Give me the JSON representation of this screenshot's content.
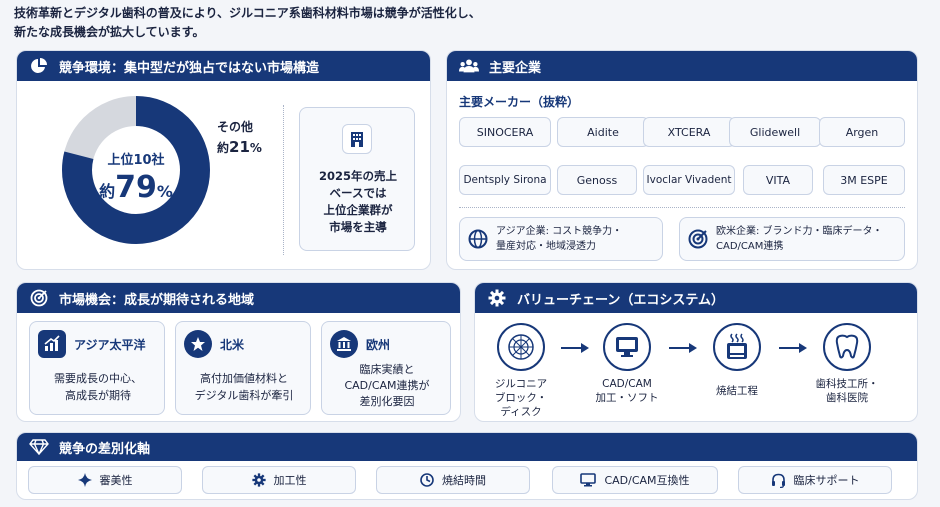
{
  "intro": {
    "line1": "技術革新とデジタル歯科の普及により、ジルコニア系歯科材料市場は競争が活性化し、",
    "line2": "新たな成長機会が拡大しています。"
  },
  "competition": {
    "header": "競争環境：集中型だが独占ではない市場構造",
    "donut": {
      "top10_label": "上位10社",
      "top10_approx": "約",
      "top10_value": "79",
      "top10_unit": "%",
      "top10_share": 79,
      "other_label": "その他",
      "other_approx": "約",
      "other_value": "21",
      "other_unit": "%",
      "other_share": 21
    },
    "note": {
      "line1": "2025年の売上",
      "line2": "ベースでは",
      "line3": "上位企業群が",
      "line4": "市場を主導"
    }
  },
  "companies": {
    "header": "主要企業",
    "subtitle": "主要メーカー（抜粋）",
    "makers": [
      "SINOCERA",
      "Aidite",
      "XTCERA",
      "Glidewell",
      "Argen",
      "Dentsply Sirona",
      "Genoss",
      "Ivoclar Vivadent",
      "VITA",
      "3M ESPE"
    ],
    "asia": {
      "line1": "アジア企業: コスト競争力・",
      "line2": "量産対応・地域浸透力"
    },
    "western": {
      "line1": "欧米企業: ブランド力・臨床データ・",
      "line2": "CAD/CAM連携"
    }
  },
  "opportunity": {
    "header": "市場機会：成長が期待される地域",
    "regions": [
      {
        "title": "アジア太平洋",
        "line1": "需要成長の中心、",
        "line2": "高成長が期待",
        "line3": ""
      },
      {
        "title": "北米",
        "line1": "高付加価値材料と",
        "line2": "デジタル歯科が牽引",
        "line3": ""
      },
      {
        "title": "欧州",
        "line1": "臨床実績と",
        "line2": "CAD/CAM連携が",
        "line3": "差別化要因"
      }
    ]
  },
  "valuechain": {
    "header": "バリューチェーン（エコシステム）",
    "steps": [
      {
        "line1": "ジルコニア",
        "line2": "ブロック・",
        "line3": "ディスク"
      },
      {
        "line1": "CAD/CAM",
        "line2": "加工・ソフト",
        "line3": ""
      },
      {
        "line1": "焼結工程",
        "line2": "",
        "line3": ""
      },
      {
        "line1": "歯科技工所・",
        "line2": "歯科医院",
        "line3": ""
      }
    ]
  },
  "differentiation": {
    "header": "競争の差別化軸",
    "items": [
      "審美性",
      "加工性",
      "焼結時間",
      "CAD/CAM互換性",
      "臨床サポート"
    ]
  },
  "colors": {
    "navy": "#173879",
    "grey": "#d5d8de",
    "bg": "#f3f5f9"
  }
}
